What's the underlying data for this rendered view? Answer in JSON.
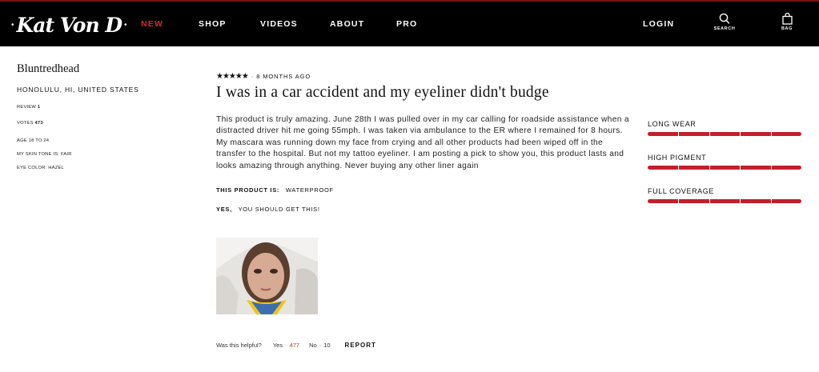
{
  "nav": {
    "logo_text": "Kat Von D",
    "links": [
      "NEW",
      "SHOP",
      "VIDEOS",
      "ABOUT",
      "PRO"
    ],
    "login": "LOGIN",
    "search_caption": "SEARCH",
    "bag_caption": "BAG",
    "accent": "#e0202e"
  },
  "profile": {
    "username": "Bluntredhead",
    "location": "HONOLULU, HI, UNITED STATES",
    "review_label": "REVIEW",
    "review_count": "1",
    "votes_label": "VOTES",
    "votes_count": "473",
    "age": "AGE 18 TO 24",
    "skin_tone": "MY SKIN TONE IS: FAIR",
    "eye_color": "EYE COLOR: HAZEL"
  },
  "review": {
    "stars": "★★★★★",
    "rating": 5,
    "time": "· 8 MONTHS AGO",
    "title": "I was in a car accident and my eyeliner didn't budge",
    "body": "This product is truly amazing. June 28th I was pulled over in my car calling for roadside assistance when a distracted driver hit me going 55mph. I was taken via ambulance to the ER where I remained for 8 hours. My mascara was running down my face from crying and all other products had been wiped off in the transfer to the hospital. But not my tattoo eyeliner. I am posting a pick to show you, this product lasts and looks amazing through anything. Never buying any other liner again",
    "attribute_label": "THIS PRODUCT IS:",
    "attribute_value": "WATERPROOF",
    "recommend_yes": "YES,",
    "recommend_text": "YOU SHOULD GET THIS!"
  },
  "helpful": {
    "question": "Was this helpful?",
    "yes_label": "Yes",
    "yes_count": "477",
    "no_label": "No",
    "no_count": "10",
    "report": "REPORT"
  },
  "ratings": [
    {
      "label": "LONG WEAR",
      "fraction": 1.0
    },
    {
      "label": "HIGH PIGMENT",
      "fraction": 1.0
    },
    {
      "label": "FULL COVERAGE",
      "fraction": 1.0
    }
  ],
  "colors": {
    "bar": "#c21f2c",
    "nav_bg": "#000000"
  }
}
